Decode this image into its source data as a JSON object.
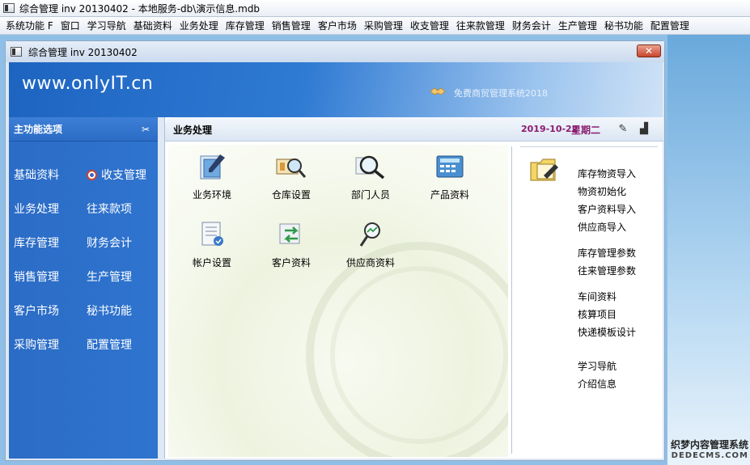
{
  "window": {
    "title": "综合管理 inv 20130402 - 本地服务-db\\演示信息.mdb"
  },
  "menu": [
    "系统功能 F",
    "窗口",
    "学习导航",
    "基础资料",
    "业务处理",
    "库存管理",
    "销售管理",
    "客户市场",
    "采购管理",
    "收支管理",
    "往来款管理",
    "财务会计",
    "生产管理",
    "秘书功能",
    "配置管理"
  ],
  "inner_window": {
    "title": "综合管理 inv 20130402",
    "close_label": "✕"
  },
  "banner": {
    "logo": "www.onlyIT.cn",
    "subtitle": "免费商贸管理系统2018"
  },
  "sidebar": {
    "header": "主功能选项",
    "rows": [
      [
        "基础资料",
        "收支管理"
      ],
      [
        "业务处理",
        "往来款项"
      ],
      [
        "库存管理",
        "财务会计"
      ],
      [
        "销售管理",
        "生产管理"
      ],
      [
        "客户市场",
        "秘书功能"
      ],
      [
        "采购管理",
        "配置管理"
      ]
    ]
  },
  "pane": {
    "title": "业务处理",
    "date": "2019-10-22",
    "weekday": "星期二",
    "tiles": [
      {
        "label": "业务环境",
        "icon": "document-pen-icon"
      },
      {
        "label": "仓库设置",
        "icon": "warehouse-magnifier-icon"
      },
      {
        "label": "部门人员",
        "icon": "magnifier-people-icon"
      },
      {
        "label": "产品资料",
        "icon": "calculator-icon"
      },
      {
        "label": "帐户设置",
        "icon": "form-checkmark-icon"
      },
      {
        "label": "客户资料",
        "icon": "swap-arrows-icon"
      },
      {
        "label": "供应商资料",
        "icon": "magnifier-chart-icon"
      }
    ],
    "link_groups": [
      [
        "库存物资导入",
        "物资初始化",
        "客户资料导入",
        "供应商导入"
      ],
      [
        "库存管理参数",
        "往来管理参数"
      ],
      [
        "车间资料",
        "核算项目",
        "快递模板设计"
      ],
      [
        "学习导航",
        "介绍信息"
      ]
    ]
  },
  "watermark": {
    "line1": "织梦内容管理系统",
    "line2": "DEDECMS.COM"
  },
  "colors": {
    "sidebar": "#2b6cc6",
    "banner": "#1d64c1",
    "date": "#8a1b6f"
  }
}
